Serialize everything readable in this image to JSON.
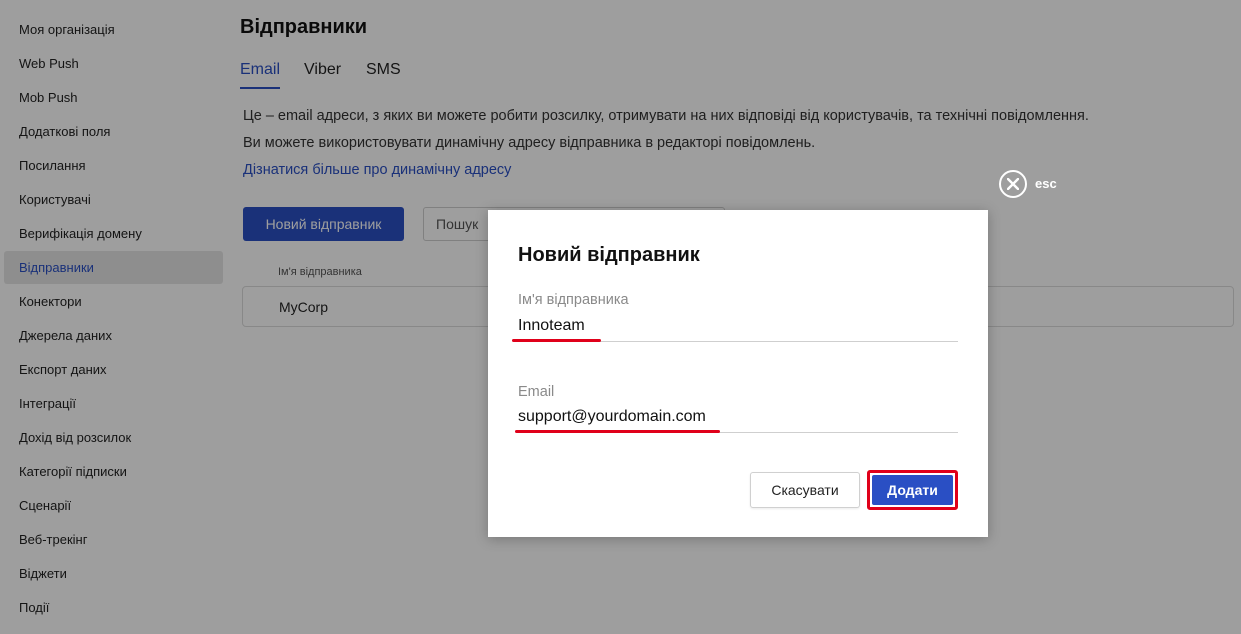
{
  "sidebar": {
    "items": [
      {
        "label": "Моя організація"
      },
      {
        "label": "Web Push"
      },
      {
        "label": "Mob Push"
      },
      {
        "label": "Додаткові поля"
      },
      {
        "label": "Посилання"
      },
      {
        "label": "Користувачі"
      },
      {
        "label": "Верифікація домену"
      },
      {
        "label": "Відправники",
        "active": true
      },
      {
        "label": "Конектори"
      },
      {
        "label": "Джерела даних"
      },
      {
        "label": "Експорт даних"
      },
      {
        "label": "Інтеграції"
      },
      {
        "label": "Дохід від розсилок"
      },
      {
        "label": "Категорії підписки"
      },
      {
        "label": "Сценарії"
      },
      {
        "label": "Веб-трекінг"
      },
      {
        "label": "Віджети"
      },
      {
        "label": "Події"
      }
    ]
  },
  "main": {
    "title": "Відправники",
    "tabs": [
      {
        "label": "Email",
        "active": true
      },
      {
        "label": "Viber"
      },
      {
        "label": "SMS"
      }
    ],
    "description_line1": "Це – email адреси, з яких ви можете робити розсилку, отримувати на них відповіді від користувачів, та технічні повідомлення.",
    "description_line2": "Ви можете використовувати динамічну адресу відправника в редакторі повідомлень.",
    "learn_more": "Дізнатися більше про динамічну адресу",
    "new_button": "Новий відправник",
    "search_placeholder": "Пошук",
    "table": {
      "columns": [
        "Ім'я відправника"
      ],
      "rows": [
        [
          "MyCorp"
        ]
      ]
    }
  },
  "overlay": {
    "close_label": "esc"
  },
  "modal": {
    "title": "Новий відправник",
    "name_label": "Ім'я відправника",
    "name_value": "Innoteam",
    "email_label": "Email",
    "email_value": "support@yourdomain.com",
    "cancel_label": "Скасувати",
    "add_label": "Додати"
  },
  "colors": {
    "accent": "#2a4fc4",
    "highlight": "#e0001a",
    "overlay": "rgba(0,0,0,0.38)"
  },
  "icons": {
    "close": "close-circle-icon"
  }
}
